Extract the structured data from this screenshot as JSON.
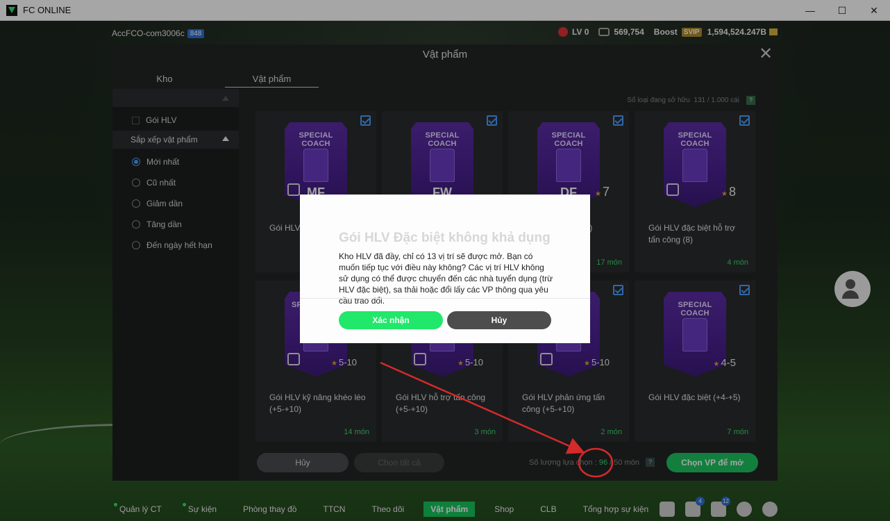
{
  "window": {
    "title": "FC ONLINE"
  },
  "topbar": {
    "account": "AccFCO-com3006c",
    "account_badge": "848",
    "level": "LV 0",
    "coins": "569,754",
    "boost_label": "Boost",
    "svip": "SVIP",
    "bp": "1,594,524.247B"
  },
  "panel": {
    "title": "Vật phẩm",
    "tabs": [
      {
        "label": "Kho"
      },
      {
        "label": "Vật phẩm"
      }
    ],
    "owned_label": "Số loại đang sở hữu",
    "owned_value": "131 / 1.000 cái",
    "owned_help": "?"
  },
  "sidebar": {
    "filter_item": "Gói HLV",
    "sort_header": "Sắp xếp vật phẩm",
    "sort_options": [
      {
        "label": "Mới nhất",
        "selected": true
      },
      {
        "label": "Cũ nhất",
        "selected": false
      },
      {
        "label": "Giảm dần",
        "selected": false
      },
      {
        "label": "Tăng dần",
        "selected": false
      },
      {
        "label": "Đến ngày hết hạn",
        "selected": false
      }
    ]
  },
  "cards": [
    {
      "badge": "SPECIAL COACH",
      "pos": "MF",
      "rating": "",
      "name": "Gói HLV",
      "qty": ""
    },
    {
      "badge": "SPECIAL COACH",
      "pos": "FW",
      "rating": "",
      "name": "",
      "qty": ""
    },
    {
      "badge": "SPECIAL COACH",
      "pos": "DF",
      "rating": "7",
      "name": "t (7)",
      "qty": "17 món"
    },
    {
      "badge": "SPECIAL COACH",
      "pos": "",
      "rating": "8",
      "name": "Gói HLV đặc biệt hỗ trợ tấn công (8)",
      "qty": "4 món"
    },
    {
      "badge": "SP",
      "pos": "",
      "rating": "5-10",
      "name": "Gói HLV kỹ năng khéo léo (+5-+10)",
      "qty": "14 món"
    },
    {
      "badge": "",
      "pos": "",
      "rating": "5-10",
      "name": "Gói HLV hỗ trợ tấn công (+5-+10)",
      "qty": "3 món"
    },
    {
      "badge": "",
      "pos": "",
      "rating": "5-10",
      "name": "Gói HLV phản ứng tấn công (+5-+10)",
      "qty": "2 món"
    },
    {
      "badge": "SPECIAL COACH",
      "pos": "",
      "rating": "4-5",
      "name": "Gói HLV đặc biệt (+4-+5)",
      "qty": "7 món"
    }
  ],
  "footer": {
    "cancel": "Hủy",
    "select_all": "Chọn tất cả",
    "selection_label": "Số lượng lựa chọn :",
    "selection_current": "96",
    "selection_max": "/ 50 món",
    "help": "?",
    "open_button": "Chọn VP để mở"
  },
  "modal": {
    "title": "Gói HLV Đặc biệt không khả dụng",
    "message": "Kho HLV đã đầy, chỉ có 13 vị trí sẽ được mở. Bạn có muốn tiếp tục với điều này không? Các vị trí HLV không sử dụng có thể được chuyển đến các nhà tuyển dụng (trừ HLV đặc biệt), sa thải hoặc đổi lấy các VP thông qua yêu cầu trao đổi.",
    "confirm": "Xác nhận",
    "cancel": "Hủy"
  },
  "nav": {
    "items": [
      {
        "label": "Quản lý CT",
        "dot": true,
        "active": false
      },
      {
        "label": "Sự kiện",
        "dot": true,
        "active": false
      },
      {
        "label": "Phòng thay đồ",
        "dot": false,
        "active": false
      },
      {
        "label": "TTCN",
        "dot": false,
        "active": false
      },
      {
        "label": "Theo dõi",
        "dot": false,
        "active": false
      },
      {
        "label": "Vật phẩm",
        "dot": false,
        "active": true
      },
      {
        "label": "Shop",
        "dot": false,
        "active": false
      },
      {
        "label": "CLB",
        "dot": false,
        "active": false
      },
      {
        "label": "Tổng hợp sự kiện",
        "dot": false,
        "active": false
      }
    ],
    "icons": [
      {
        "name": "chat-icon",
        "badge": ""
      },
      {
        "name": "home-icon",
        "badge": "4"
      },
      {
        "name": "bell-icon",
        "badge": "12"
      },
      {
        "name": "profile-icon",
        "badge": ""
      },
      {
        "name": "settings-icon",
        "badge": ""
      }
    ]
  },
  "colors": {
    "accent": "#1ec460",
    "highlight_red": "#d42a2a",
    "selection": "#4aa0ff"
  }
}
